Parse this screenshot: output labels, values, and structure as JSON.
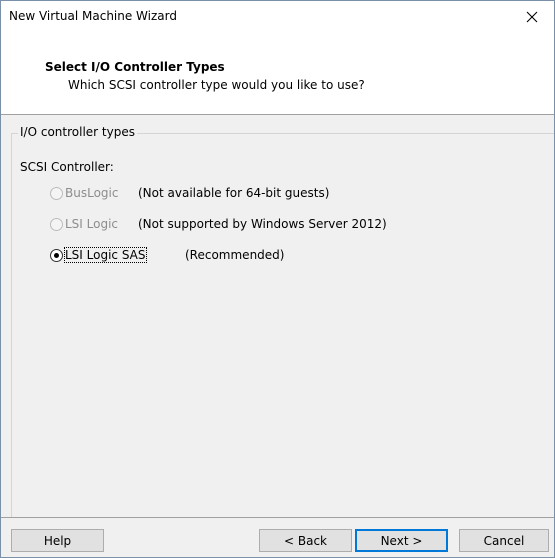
{
  "window": {
    "title": "New Virtual Machine Wizard",
    "close_icon": "close-icon"
  },
  "header": {
    "title": "Select I/O Controller Types",
    "subtitle": "Which SCSI controller type would you like to use?"
  },
  "group": {
    "legend": "I/O controller types",
    "scsi_label": "SCSI Controller:",
    "options": [
      {
        "label": "BusLogic",
        "note": "(Not available for 64-bit guests)",
        "enabled": false,
        "selected": false
      },
      {
        "label": "LSI Logic",
        "note": "(Not supported by Windows Server 2012)",
        "enabled": false,
        "selected": false
      },
      {
        "label": "LSI Logic SAS",
        "note": "(Recommended)",
        "enabled": true,
        "selected": true
      }
    ]
  },
  "buttons": {
    "help": "Help",
    "back": "< Back",
    "next": "Next >",
    "cancel": "Cancel"
  },
  "colors": {
    "accent": "#0078d7",
    "disabled_text": "#8d8d8d"
  }
}
